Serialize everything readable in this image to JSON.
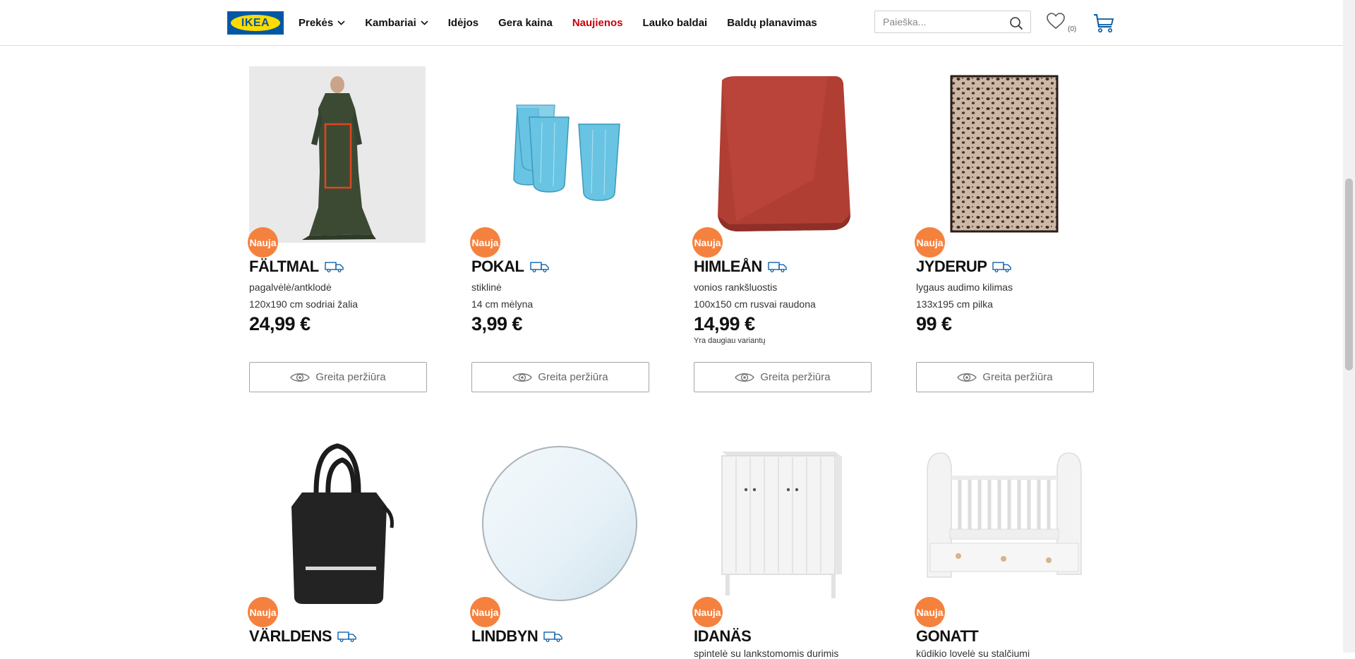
{
  "header": {
    "logo_text": "IKEA",
    "nav": [
      {
        "label": "Prekės",
        "has_dropdown": true
      },
      {
        "label": "Kambariai",
        "has_dropdown": true
      },
      {
        "label": "Idėjos",
        "has_dropdown": false
      },
      {
        "label": "Gera kaina",
        "has_dropdown": false
      },
      {
        "label": "Naujienos",
        "has_dropdown": false,
        "active": true
      },
      {
        "label": "Lauko baldai",
        "has_dropdown": false
      },
      {
        "label": "Baldų planavimas",
        "has_dropdown": false
      }
    ],
    "search": {
      "placeholder": "Paieška...",
      "icon": "search-icon"
    },
    "wishlist": {
      "icon": "heart-icon",
      "count": "(0)"
    },
    "cart": {
      "icon": "cart-icon"
    }
  },
  "colors": {
    "accent_red": "#cc0008",
    "badge_orange": "#f5813e",
    "ikea_blue": "#0058a3",
    "ikea_yellow": "#ffdb00"
  },
  "products": [
    {
      "badge": "Nauja",
      "name": "FÄLTMAL",
      "desc1": "pagalvėlė/antklodė",
      "desc2": "120x190 cm sodriai žalia",
      "price": "24,99 €",
      "note": "",
      "quick_view": "Greita peržiūra"
    },
    {
      "badge": "Nauja",
      "name": "POKAL",
      "desc1": "stiklinė",
      "desc2": "14 cm mėlyna",
      "price": "3,99 €",
      "note": "",
      "quick_view": "Greita peržiūra"
    },
    {
      "badge": "Nauja",
      "name": "HIMLEÅN",
      "desc1": "vonios rankšluostis",
      "desc2": "100x150 cm rusvai raudona",
      "price": "14,99 €",
      "note": "Yra daugiau variantų",
      "quick_view": "Greita peržiūra"
    },
    {
      "badge": "Nauja",
      "name": "JYDERUP",
      "desc1": "lygaus audimo kilimas",
      "desc2": "133x195 cm pilka",
      "price": "99 €",
      "note": "",
      "quick_view": "Greita peržiūra"
    },
    {
      "badge": "Nauja",
      "name": "VÄRLDENS",
      "desc1": "",
      "desc2": "",
      "price": "",
      "note": "",
      "quick_view": ""
    },
    {
      "badge": "Nauja",
      "name": "LINDBYN",
      "desc1": "",
      "desc2": "",
      "price": "",
      "note": "",
      "quick_view": ""
    },
    {
      "badge": "Nauja",
      "name": "IDANÄS",
      "desc1": "spintelė su lankstomomis durimis",
      "desc2": "",
      "price": "",
      "note": "",
      "quick_view": ""
    },
    {
      "badge": "Nauja",
      "name": "GONATT",
      "desc1": "kūdikio lovelė su stalčiumi",
      "desc2": "",
      "price": "",
      "note": "",
      "quick_view": ""
    }
  ]
}
